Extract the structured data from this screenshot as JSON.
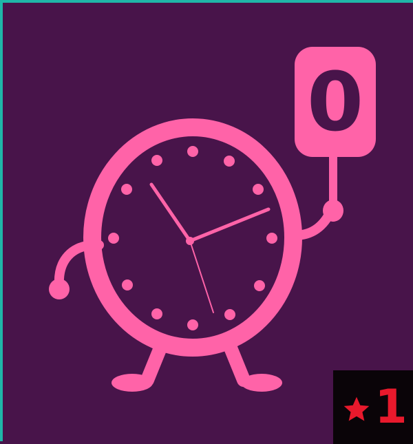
{
  "tile": {
    "background_color": "#48144a",
    "accent_color": "#ff63a8",
    "border_color": "#1fb7a8",
    "mascot_icon": "clock-mascot-icon"
  },
  "sign": {
    "value": "0"
  },
  "badge": {
    "icon": "star-icon",
    "count": "1",
    "color": "#e8192c"
  }
}
